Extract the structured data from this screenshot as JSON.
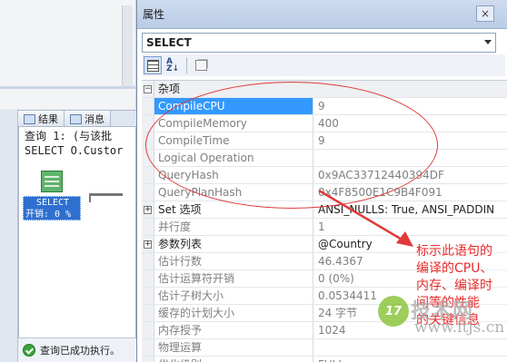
{
  "background_window": {
    "tabs": [
      {
        "label": "结果",
        "icon": "grid-icon"
      },
      {
        "label": "消息",
        "icon": "message-icon"
      }
    ],
    "output_lines": [
      "查询 1: (与该批",
      "SELECT O.Custor"
    ],
    "plan_node": {
      "label": "SELECT",
      "cost": "开销: 0 %"
    },
    "status_text": "查询已成功执行。"
  },
  "properties": {
    "title": "属性",
    "close_glyph": "×",
    "object": "SELECT",
    "toolbar": {
      "categorized_icon": "categorized-icon",
      "alphabetical_icon": "sort-az-icon",
      "pages_icon": "property-pages-icon"
    },
    "category": {
      "label": "杂项",
      "expander": "⊟"
    },
    "rows": [
      {
        "name": "CompileCPU",
        "value": "9",
        "selected": true
      },
      {
        "name": "CompileMemory",
        "value": "400"
      },
      {
        "name": "CompileTime",
        "value": "9"
      },
      {
        "name": "Logical Operation",
        "value": ""
      },
      {
        "name": "QueryHash",
        "value": "0x9AC33712440394DF"
      },
      {
        "name": "QueryPlanHash",
        "value": "0x4F8500E1C9B4F091"
      },
      {
        "name": "Set 选项",
        "value": "ANSI_NULLS: True, ANSI_PADDIN",
        "expandable": true
      },
      {
        "name": "并行度",
        "value": "1"
      },
      {
        "name": "参数列表",
        "value": "@Country",
        "expandable": true
      },
      {
        "name": "估计行数",
        "value": "46.4367"
      },
      {
        "name": "估计运算符开销",
        "value": "0 (0%)"
      },
      {
        "name": "估计子树大小",
        "value": "0.0534411"
      },
      {
        "name": "缓存的计划大小",
        "value": "24 字节"
      },
      {
        "name": "内存授予",
        "value": "1024"
      },
      {
        "name": "物理运算",
        "value": ""
      },
      {
        "name": "优化级别",
        "value": "FULL"
      }
    ]
  },
  "annotation": {
    "lines": [
      "标示此语句的",
      "编译的CPU、",
      "内存、编译时",
      "间等的性能",
      "的关键信息"
    ],
    "color": "#e82a2a"
  },
  "watermark": {
    "logo": "17",
    "text": "技术网",
    "url": "www.itjs.cn"
  }
}
